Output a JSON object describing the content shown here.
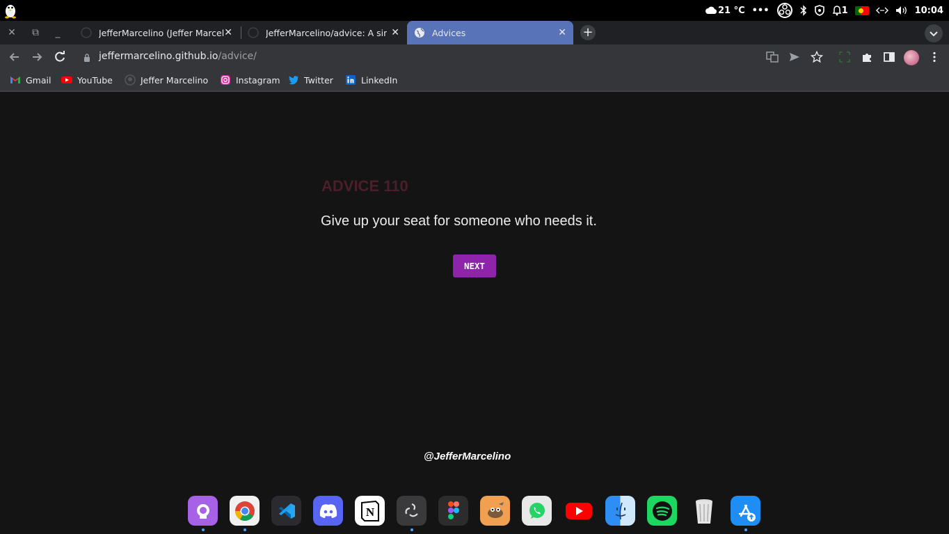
{
  "system_bar": {
    "weather": "21 °C",
    "more": "•••",
    "notifications_count": "1",
    "time": "10:04"
  },
  "tabs": [
    {
      "title": "JefferMarcelino (Jeffer Marcelino)",
      "active": false
    },
    {
      "title": "JefferMarcelino/advice: A simple",
      "active": false
    },
    {
      "title": "Advices",
      "active": true
    }
  ],
  "toolbar": {
    "url_host": "jeffermarcelino.github.io",
    "url_path": "/advice/"
  },
  "bookmarks": [
    {
      "label": "Gmail",
      "icon": "gmail-icon"
    },
    {
      "label": "YouTube",
      "icon": "youtube-icon"
    },
    {
      "label": "Jeffer Marcelino",
      "icon": "github-icon"
    },
    {
      "label": "Instagram",
      "icon": "instagram-icon"
    },
    {
      "label": "Twitter",
      "icon": "twitter-icon"
    },
    {
      "label": "LinkedIn",
      "icon": "linkedin-icon"
    }
  ],
  "page": {
    "advice_title": "ADVICE 110",
    "advice_text": "Give up your seat for someone who needs it.",
    "next_label": "NEXT",
    "footer_handle": "@JefferMarcelino"
  },
  "dock": [
    {
      "name": "github-desktop-icon",
      "color": "#a661e6",
      "running": true
    },
    {
      "name": "chrome-icon",
      "color": "#f1f1f1",
      "running": true
    },
    {
      "name": "vscode-icon",
      "color": "#2b2b2f",
      "running": false
    },
    {
      "name": "discord-icon",
      "color": "#5865f2",
      "running": false
    },
    {
      "name": "notion-icon",
      "color": "#ffffff",
      "running": false
    },
    {
      "name": "obs-icon",
      "color": "#3a3a3d",
      "running": true
    },
    {
      "name": "figma-icon",
      "color": "#2c2c2c",
      "running": false
    },
    {
      "name": "gimp-icon",
      "color": "#f0a050",
      "running": false
    },
    {
      "name": "whatsapp-icon",
      "color": "#e8e8e8",
      "running": false
    },
    {
      "name": "youtube-app-icon",
      "color": "#141414",
      "running": false
    },
    {
      "name": "finder-icon",
      "color": "#3aa7f5",
      "running": false
    },
    {
      "name": "spotify-icon",
      "color": "#1ed760",
      "running": false
    },
    {
      "name": "trash-icon",
      "color": "#141414",
      "running": false
    },
    {
      "name": "app-store-icon",
      "color": "#1e8ef5",
      "running": true
    }
  ]
}
